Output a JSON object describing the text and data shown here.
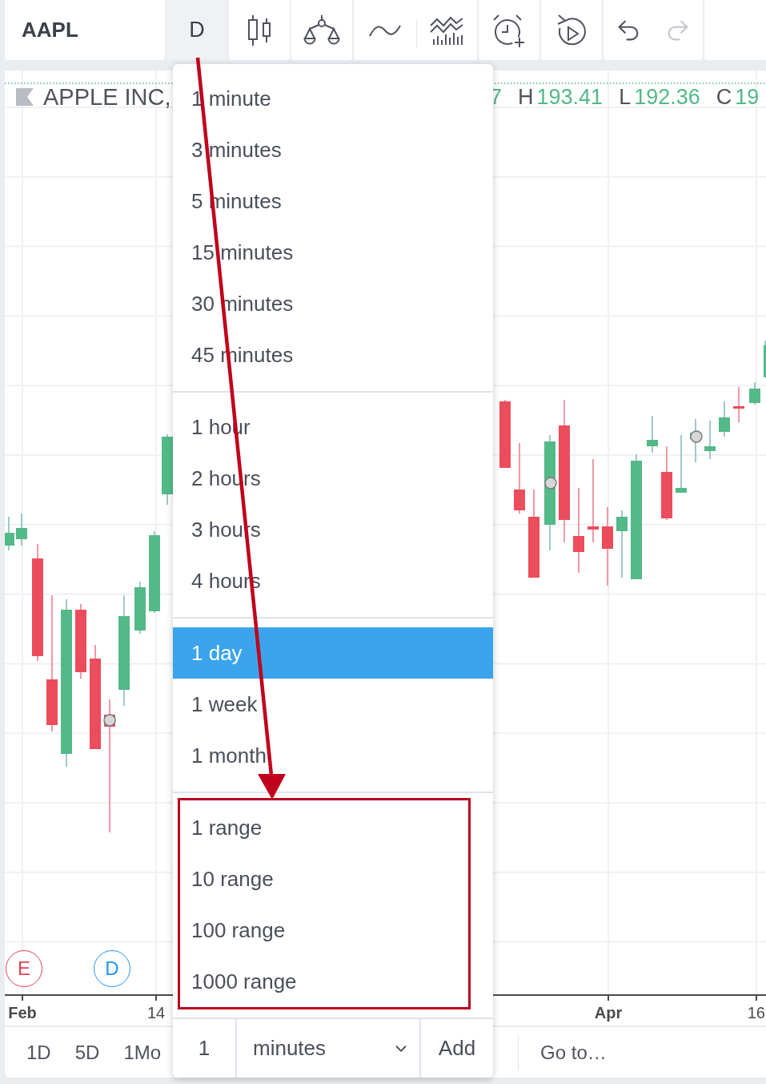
{
  "toolbar": {
    "symbol": "AAPL",
    "interval": {
      "label": "D",
      "expanded": true
    },
    "history": [
      {
        "kind": "undo",
        "disabled": false
      },
      {
        "kind": "redo",
        "disabled": true
      }
    ]
  },
  "legend": {
    "title": "APPLE INC,",
    "fields": [
      {
        "value": "7"
      },
      {
        "label": "H",
        "value": "193.41"
      },
      {
        "label": "L",
        "value": "192.36"
      },
      {
        "label": "C",
        "value": "19"
      }
    ]
  },
  "chart": {
    "events": [
      {
        "label": "E",
        "color": "#e0424f"
      },
      {
        "label": "D",
        "color": "#2196f3"
      }
    ],
    "time_axis": [
      {
        "label": "Feb",
        "kind": "month"
      },
      {
        "label": "14",
        "kind": "day"
      },
      {
        "label": "Apr",
        "kind": "month"
      },
      {
        "label": "16",
        "kind": "day"
      }
    ]
  },
  "bottom_bar": {
    "ranges": [
      {
        "label": "1D"
      },
      {
        "label": "5D"
      },
      {
        "label": "1Mo"
      }
    ],
    "goto": "Go to…"
  },
  "interval_menu": {
    "sections": [
      {
        "annotated": false,
        "items": [
          {
            "label": "1 minute",
            "selected": false
          },
          {
            "label": "3 minutes",
            "selected": false
          },
          {
            "label": "5 minutes",
            "selected": false
          },
          {
            "label": "15 minutes",
            "selected": false
          },
          {
            "label": "30 minutes",
            "selected": false
          },
          {
            "label": "45 minutes",
            "selected": false
          }
        ]
      },
      {
        "annotated": false,
        "items": [
          {
            "label": "1 hour",
            "selected": false
          },
          {
            "label": "2 hours",
            "selected": false
          },
          {
            "label": "3 hours",
            "selected": false
          },
          {
            "label": "4 hours",
            "selected": false
          }
        ]
      },
      {
        "annotated": false,
        "items": [
          {
            "label": "1 day",
            "selected": true
          },
          {
            "label": "1 week",
            "selected": false
          },
          {
            "label": "1 month",
            "selected": false
          }
        ]
      },
      {
        "annotated": true,
        "items": [
          {
            "label": "1 range",
            "selected": false
          },
          {
            "label": "10 range",
            "selected": false
          },
          {
            "label": "100 range",
            "selected": false
          },
          {
            "label": "1000 range",
            "selected": false
          }
        ]
      }
    ],
    "custom": {
      "value": "1",
      "unit": "minutes",
      "button": "Add"
    }
  }
}
